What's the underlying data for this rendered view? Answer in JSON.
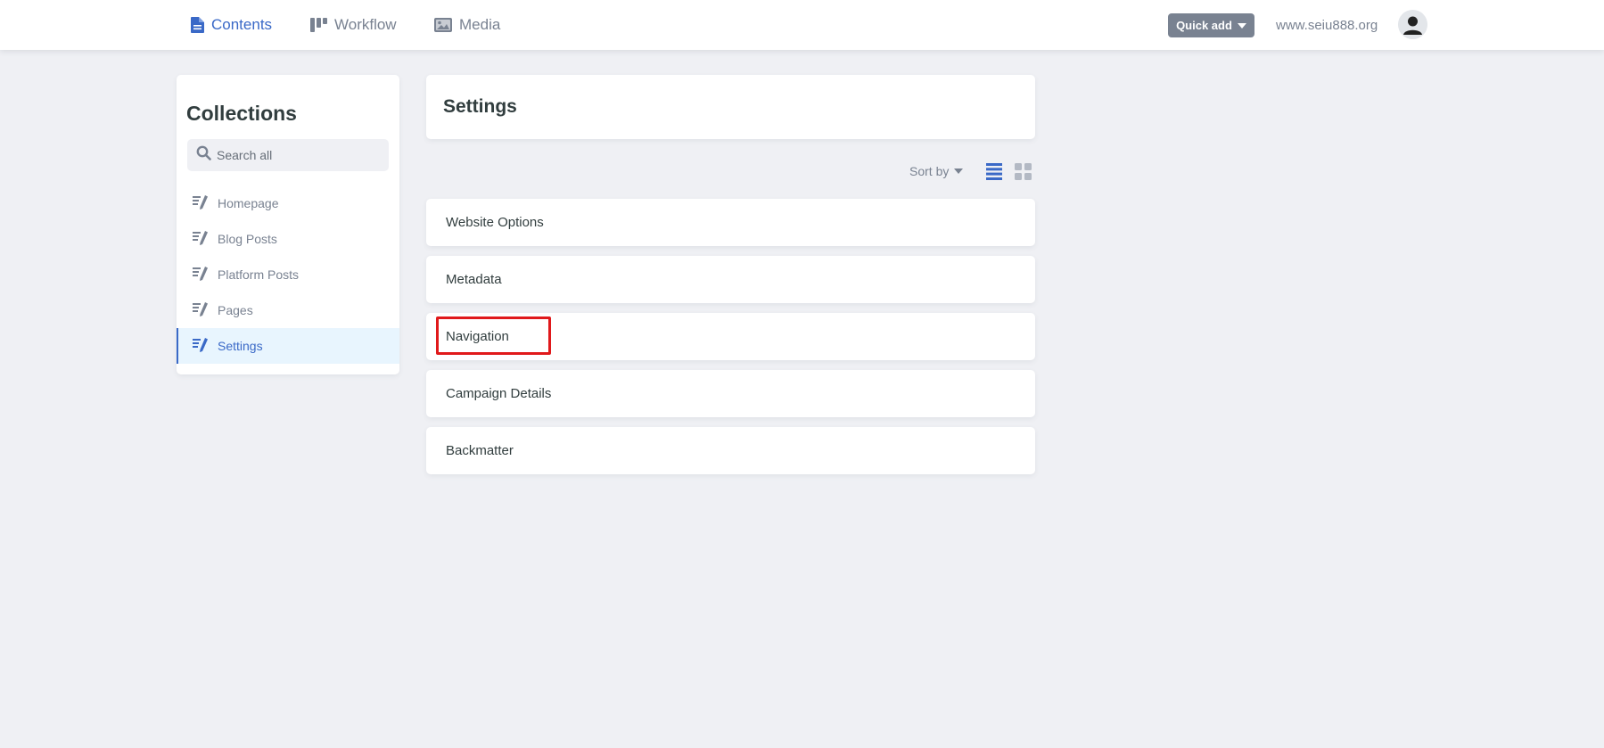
{
  "topbar": {
    "nav": [
      {
        "label": "Contents",
        "icon": "file-text-icon",
        "active": true
      },
      {
        "label": "Workflow",
        "icon": "workflow-columns-icon",
        "active": false
      },
      {
        "label": "Media",
        "icon": "image-icon",
        "active": false
      }
    ],
    "quick_add_label": "Quick add",
    "site_url": "www.seiu888.org",
    "avatar_icon": "user-avatar-icon"
  },
  "sidebar": {
    "title": "Collections",
    "search_placeholder": "Search all",
    "items": [
      {
        "label": "Homepage",
        "icon": "write-icon",
        "active": false
      },
      {
        "label": "Blog Posts",
        "icon": "write-icon",
        "active": false
      },
      {
        "label": "Platform Posts",
        "icon": "write-icon",
        "active": false
      },
      {
        "label": "Pages",
        "icon": "write-icon",
        "active": false
      },
      {
        "label": "Settings",
        "icon": "write-icon",
        "active": true
      }
    ]
  },
  "main": {
    "title": "Settings",
    "sort_by_label": "Sort by",
    "view_modes": [
      "list-view-icon",
      "grid-view-icon"
    ],
    "entries": [
      {
        "label": "Website Options"
      },
      {
        "label": "Metadata"
      },
      {
        "label": "Navigation"
      },
      {
        "label": "Campaign Details"
      },
      {
        "label": "Backmatter"
      }
    ],
    "highlighted_entry": "Navigation"
  },
  "colors": {
    "accent": "#3a69c7",
    "muted": "#798291",
    "background": "#eff0f4",
    "highlight": "#e0191b"
  }
}
